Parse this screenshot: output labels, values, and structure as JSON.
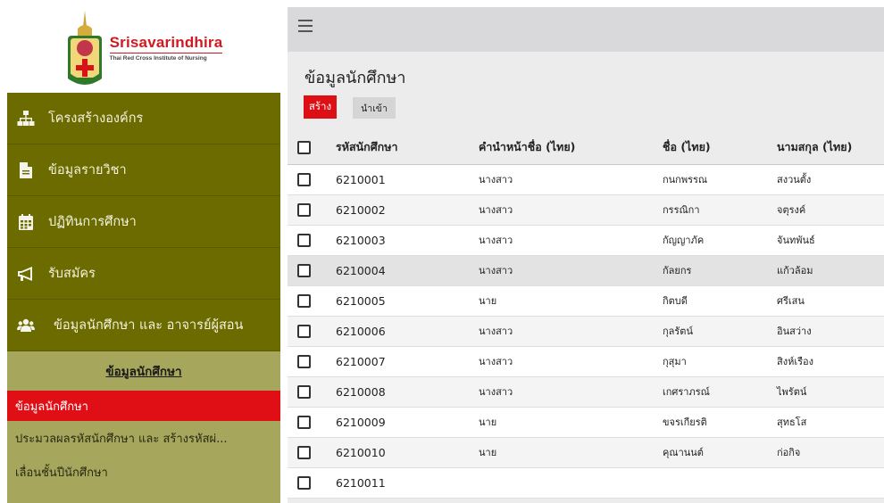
{
  "logo": {
    "name": "Srisavarindhira",
    "subtitle": "Thai Red Cross Institute of Nursing"
  },
  "sidebar": {
    "items": [
      {
        "label": "โครงสร้างองค์กร",
        "icon": "sitemap-icon"
      },
      {
        "label": "ข้อมูลรายวิชา",
        "icon": "file-icon"
      },
      {
        "label": "ปฏิทินการศึกษา",
        "icon": "calendar-icon"
      },
      {
        "label": "รับสมัคร",
        "icon": "megaphone-icon"
      },
      {
        "label": "ข้อมูลนักศึกษา และ อาจารย์ผู้สอน",
        "icon": "users-icon"
      }
    ],
    "submenu": {
      "title": "ข้อมูลนักศึกษา",
      "items": [
        {
          "label": "ข้อมูลนักศึกษา",
          "active": true
        },
        {
          "label": "ประมวลผลรหัสนักศึกษา และ สร้างรหัสผ่...",
          "active": false
        },
        {
          "label": "เลื่อนชั้นปีนักศึกษา",
          "active": false
        }
      ]
    }
  },
  "main": {
    "title": "ข้อมูลนักศึกษา",
    "create_label": "สร้าง",
    "import_label": "นำเข้า"
  },
  "table": {
    "columns": [
      "รหัสนักศึกษา",
      "คำนำหน้าชื่อ (ไทย)",
      "ชื่อ (ไทย)",
      "นามสกุล (ไทย)"
    ],
    "rows": [
      [
        "6210001",
        "นางสาว",
        "กนกพรรณ",
        "สงวนตั้ง"
      ],
      [
        "6210002",
        "นางสาว",
        "กรรณิกา",
        "จตุรงค์"
      ],
      [
        "6210003",
        "นางสาว",
        "กัญญาภัค",
        "จันทพันธ์"
      ],
      [
        "6210004",
        "นางสาว",
        "กัลยกร",
        "แก้วล้อม"
      ],
      [
        "6210005",
        "นาย",
        "กิตบดี",
        "ศรีเสน"
      ],
      [
        "6210006",
        "นางสาว",
        "กุลรัตน์",
        "อินสว่าง"
      ],
      [
        "6210007",
        "นางสาว",
        "กุสุมา",
        "สิงห์เรือง"
      ],
      [
        "6210008",
        "นางสาว",
        "เกศราภรณ์",
        "ไพรัตน์"
      ],
      [
        "6210009",
        "นาย",
        "ขจรเกียรติ",
        "สุทธโส"
      ],
      [
        "6210010",
        "นาย",
        "คุณานนต์",
        "ก่อกิจ"
      ],
      [
        "6210011",
        "",
        "",
        ""
      ]
    ]
  },
  "colors": {
    "sidebar": "#6b6b00",
    "submenu": "#a6a65d",
    "accent": "#e00f15",
    "logo_text": "#d41820"
  }
}
